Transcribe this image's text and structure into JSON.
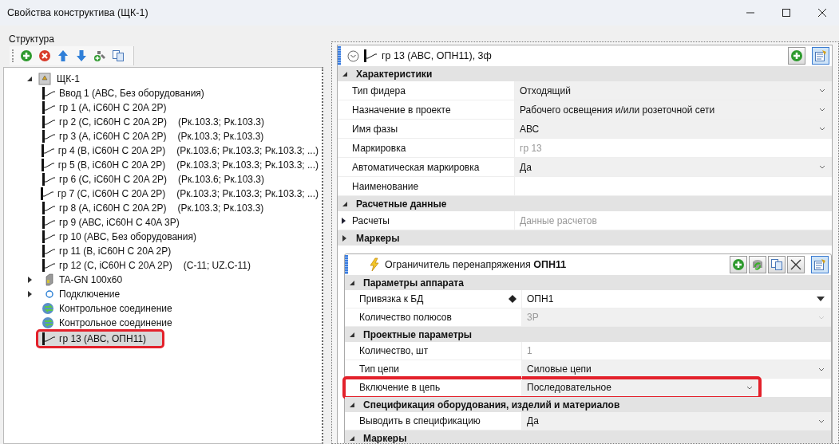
{
  "window": {
    "title": "Свойства конструктива (ЩК-1)"
  },
  "structure": {
    "title": "Структура",
    "toolbar": [
      {
        "kind": "add"
      },
      {
        "kind": "remove"
      },
      {
        "kind": "up"
      },
      {
        "kind": "down"
      },
      {
        "kind": "add-link"
      },
      {
        "kind": "copy"
      }
    ],
    "tree": [
      {
        "label": "ЩК-1",
        "kind": "panel",
        "expanded": true,
        "children": [
          {
            "label": "Ввод 1 (АВС, Без оборудования)",
            "kind": "breaker",
            "selected": false
          },
          {
            "label": "гр 1 (А, iC60H C 20A 2P)",
            "kind": "breaker",
            "selected": false
          },
          {
            "label": "гр 2 (С, iC60H C 20A 2P)",
            "refs": "(Рк.103.3; Рк.103.3)",
            "kind": "breaker",
            "selected": false
          },
          {
            "label": "гр 3 (А, iC60H C 20A 2P)",
            "refs": "(Рк.103.3; Рк.103.3)",
            "kind": "breaker",
            "selected": false
          },
          {
            "label": "гр 4 (В, iC60H C 20A 2P)",
            "refs": "(Рк.103.6; Рк.103.3; Рк.103.3; ...)",
            "kind": "breaker",
            "selected": false
          },
          {
            "label": "гр 5 (В, iC60H C 20A 2P)",
            "refs": "(Рк.103.3; Рк.103.3; Рк.103.3; ...)",
            "kind": "breaker",
            "selected": false
          },
          {
            "label": "гр 6 (С, iC60H C 20A 2P)",
            "refs": "(Рк.103.6; Рк.103.3)",
            "kind": "breaker",
            "selected": false
          },
          {
            "label": "гр 7 (С, iC60H C 20A 2P)",
            "refs": "(Рк.103.3; Рк.103.3; Рк.103.3; ...)",
            "kind": "breaker",
            "selected": false
          },
          {
            "label": "гр 8 (А, iC60H C 20A 2P)",
            "refs": "(Рк.103.3; Рк.103.3)",
            "kind": "breaker",
            "selected": false
          },
          {
            "label": "гр 9 (АВС, iC60H C 40A 3P)",
            "kind": "breaker",
            "selected": false
          },
          {
            "label": "гр 10 (АВС, Без оборудования)",
            "kind": "breaker",
            "selected": false
          },
          {
            "label": "гр 11 (В, iC60H C 20A 2P)",
            "kind": "breaker",
            "selected": false
          },
          {
            "label": "гр 12 (С, iC60H C 20A 2P)",
            "refs": "(C-11; UZ.C-11)",
            "kind": "breaker",
            "selected": false
          },
          {
            "label": "TA-GN 100x60",
            "kind": "busbar",
            "expanded": false,
            "selected": false
          },
          {
            "label": "Подключение",
            "kind": "connection",
            "expanded": false,
            "selected": false
          },
          {
            "label": "Контрольное соединение",
            "kind": "control",
            "selected": false
          },
          {
            "label": "Контрольное соединение",
            "kind": "control",
            "selected": false
          },
          {
            "label": "гр 13 (АВС, ОПН11)",
            "kind": "breaker",
            "selected": true,
            "marked": true
          }
        ]
      }
    ]
  },
  "feeder": {
    "title": "гр 13 (АВС, ОПН11), 3ф",
    "buttons": [
      {
        "kind": "add"
      },
      {
        "kind": "properties",
        "selected": true
      }
    ],
    "sections": [
      {
        "title": "Характеристики",
        "expanded": true,
        "rows": [
          {
            "label": "Тип фидера",
            "value": "Отходящий",
            "kind": "dropdown",
            "disabled": false
          },
          {
            "label": "Назначение в проекте",
            "value": "Рабочего освещения и/или розеточной сети",
            "kind": "dropdown",
            "disabled": false
          },
          {
            "label": "Имя фазы",
            "value": "АВС",
            "kind": "dropdown",
            "disabled": false
          },
          {
            "label": "Маркировка",
            "value": "гр 13",
            "kind": "text",
            "disabled": true
          },
          {
            "label": "Автоматическая маркировка",
            "value": "Да",
            "kind": "dropdown",
            "disabled": false
          },
          {
            "label": "Наименование",
            "kind": "text"
          }
        ]
      },
      {
        "title": "Расчетные данные",
        "expanded": true,
        "rows": [
          {
            "label": "Расчеты",
            "value": "Данные расчетов",
            "kind": "expand",
            "disabled": true
          }
        ]
      },
      {
        "title": "Маркеры",
        "expanded": false
      }
    ],
    "device": {
      "title": "Ограничитель перенапряжения **ОПН11**",
      "buttons": [
        {
          "kind": "add"
        },
        {
          "kind": "refresh"
        },
        {
          "kind": "copy"
        },
        {
          "kind": "delete"
        },
        {
          "kind": "properties",
          "selected": true
        }
      ],
      "sections": [
        {
          "title": "Параметры аппарата",
          "expanded": true,
          "rows": [
            {
              "label": "Привязка к БД",
              "value": "ОПН1",
              "kind": "lookup",
              "disabled": false
            },
            {
              "label": "Количество полюсов",
              "value": "3P",
              "kind": "dropdown",
              "disabled": true
            }
          ]
        },
        {
          "title": "Проектные параметры",
          "expanded": true,
          "rows": [
            {
              "label": "Количество, шт",
              "value": "1",
              "kind": "text",
              "disabled": true
            },
            {
              "label": "Тип цепи",
              "value": "Силовые цепи",
              "kind": "dropdown",
              "disabled": false
            },
            {
              "label": "Включение в цепь",
              "value": "Последовательное",
              "kind": "dropdown",
              "disabled": false,
              "marked": true
            }
          ]
        },
        {
          "title": "Спецификация оборудования, изделий и материалов",
          "expanded": true,
          "rows": [
            {
              "label": "Выводить в спецификацию",
              "value": "Да",
              "kind": "dropdown",
              "disabled": false
            }
          ]
        },
        {
          "title": "Маркеры",
          "expanded": true
        }
      ]
    }
  }
}
